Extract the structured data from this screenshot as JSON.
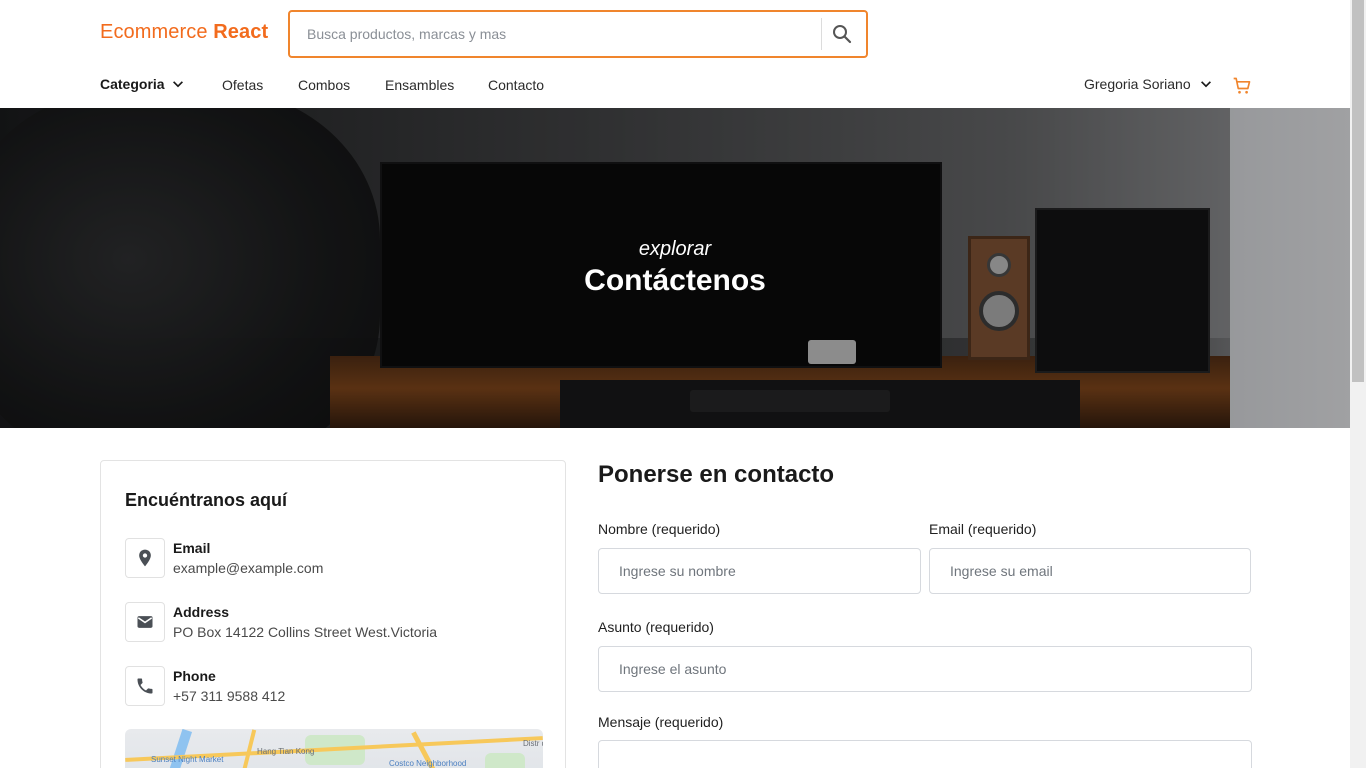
{
  "brand": {
    "name_light": "Ecommerce ",
    "name_bold": "React",
    "accent_color": "#f26b1d"
  },
  "search": {
    "placeholder": "Busca productos, marcas y mas",
    "value": "",
    "icon": "search-icon"
  },
  "nav": {
    "category_label": "Categoria",
    "links": [
      "Ofetas",
      "Combos",
      "Ensambles",
      "Contacto"
    ],
    "user_name": "Gregoria Soriano",
    "cart_icon": "cart-icon"
  },
  "hero": {
    "subtitle": "explorar",
    "title": "Contáctenos"
  },
  "info_card": {
    "title": "Encuéntranos aquí",
    "items": [
      {
        "label": "Email",
        "value": "example@example.com",
        "icon": "location-pin-icon"
      },
      {
        "label": "Address",
        "value": "PO Box 14122 Collins Street West.Victoria",
        "icon": "envelope-icon"
      },
      {
        "label": "Phone",
        "value": "+57 311 9588 412",
        "icon": "phone-icon"
      }
    ],
    "map_labels": [
      "Hang Tian Kong",
      "Sunset Night Market",
      "Distr de N",
      "Costco Neighborhood"
    ]
  },
  "contact_form": {
    "title": "Ponerse en contacto",
    "name_label": "Nombre (requerido)",
    "name_placeholder": "Ingrese su nombre",
    "email_label": "Email (requerido)",
    "email_placeholder": "Ingrese su email",
    "subject_label": "Asunto (requerido)",
    "subject_placeholder": "Ingrese el asunto",
    "message_label": "Mensaje (requerido)",
    "message_placeholder": ""
  }
}
